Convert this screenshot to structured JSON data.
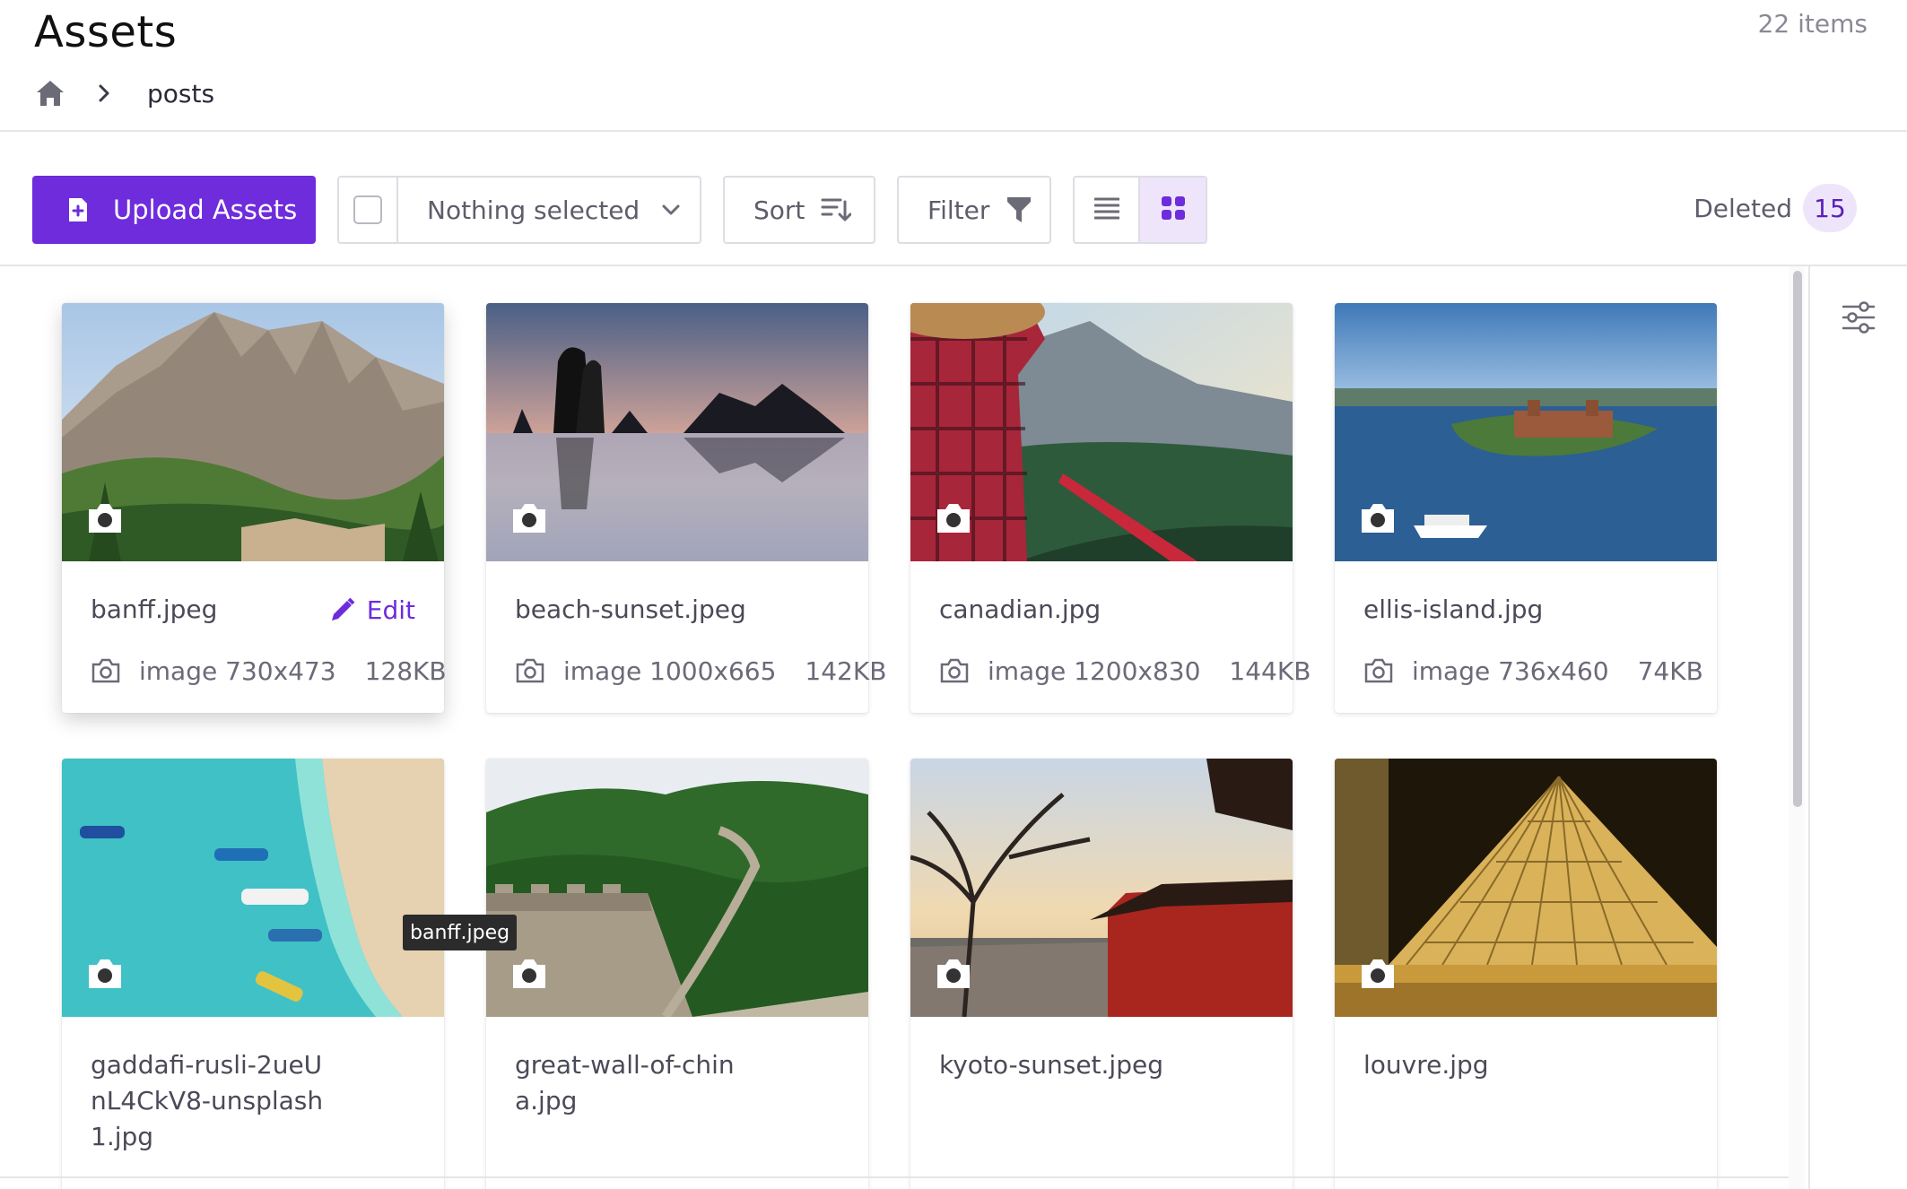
{
  "header": {
    "title": "Assets",
    "item_count": "22 items",
    "breadcrumb": {
      "home_icon": "home-icon",
      "separator_icon": "chevron-right-icon",
      "current": "posts"
    }
  },
  "toolbar": {
    "upload_label": "Upload Assets",
    "select_placeholder": "Nothing selected",
    "sort_label": "Sort",
    "filter_label": "Filter",
    "view_mode": "grid",
    "deleted_label": "Deleted",
    "deleted_count": "15"
  },
  "colors": {
    "accent": "#6e2cdc",
    "accent_light": "#eee5fb",
    "border": "#dddde3",
    "text_muted": "#6a6a78"
  },
  "tooltip": "banff.jpeg",
  "assets": [
    {
      "name": "banff.jpeg",
      "type": "image",
      "dimensions": "730x473",
      "size": "128KB",
      "edit_label": "Edit",
      "scene": "mountain"
    },
    {
      "name": "beach-sunset.jpeg",
      "type": "image",
      "dimensions": "1000x665",
      "size": "142KB",
      "scene": "beach"
    },
    {
      "name": "canadian.jpg",
      "type": "image",
      "dimensions": "1200x830",
      "size": "144KB",
      "scene": "canoe"
    },
    {
      "name": "ellis-island.jpg",
      "type": "image",
      "dimensions": "736x460",
      "size": "74KB",
      "scene": "island"
    },
    {
      "name": "gaddafi-rusli-2ueUnL4CkV8-unsplash 1.jpg",
      "name_lines": [
        "gaddafi-rusli-2ueU",
        "nL4CkV8-unsplash",
        "1.jpg"
      ],
      "scene": "lagoon"
    },
    {
      "name": "great-wall-of-china.jpg",
      "name_lines": [
        "great-wall-of-chin",
        "a.jpg"
      ],
      "scene": "wall"
    },
    {
      "name": "kyoto-sunset.jpeg",
      "scene": "kyoto"
    },
    {
      "name": "louvre.jpg",
      "scene": "louvre"
    }
  ]
}
